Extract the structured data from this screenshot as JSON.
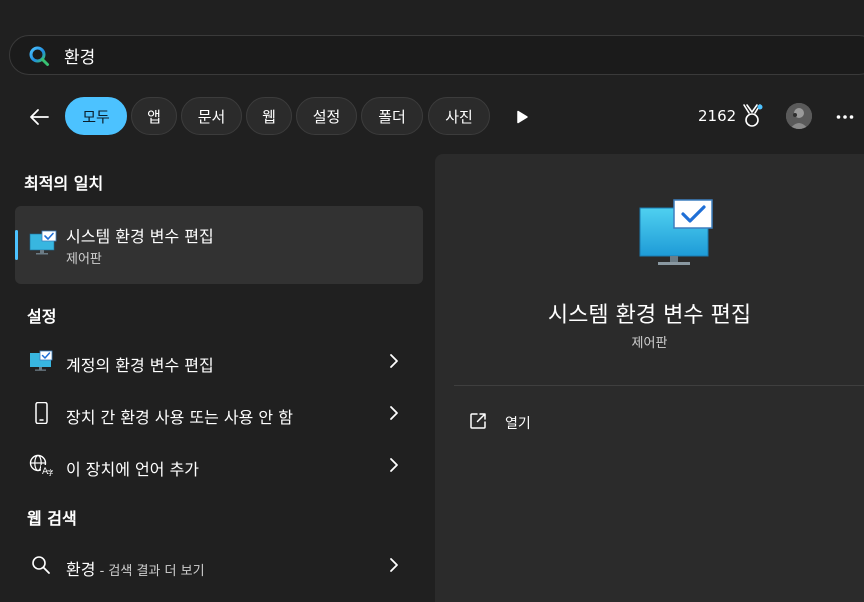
{
  "search": {
    "query": "환경"
  },
  "filters": {
    "tabs": [
      {
        "label": "모두"
      },
      {
        "label": "앱"
      },
      {
        "label": "문서"
      },
      {
        "label": "웹"
      },
      {
        "label": "설정"
      },
      {
        "label": "폴더"
      },
      {
        "label": "사진"
      }
    ],
    "active_index": 0
  },
  "header": {
    "points": "2162"
  },
  "best_match": {
    "section_title": "최적의 일치",
    "title": "시스템 환경 변수 편집",
    "subtitle": "제어판"
  },
  "settings": {
    "section_title": "설정",
    "items": [
      {
        "label": "계정의 환경 변수 편집",
        "icon": "monitor-check-icon"
      },
      {
        "label": "장치 간 환경 사용 또는 사용 안 함",
        "icon": "phone-icon"
      },
      {
        "label": "이 장치에 언어 추가",
        "icon": "language-icon"
      }
    ]
  },
  "web": {
    "section_title": "웹 검색",
    "item": {
      "query": "환경",
      "suffix": " - 검색 결과 더 보기"
    }
  },
  "preview": {
    "title": "시스템 환경 변수 편집",
    "subtitle": "제어판",
    "action_label": "열기"
  },
  "colors": {
    "accent": "#4cc2ff",
    "background": "#202020",
    "panel": "#2b2b2b"
  }
}
